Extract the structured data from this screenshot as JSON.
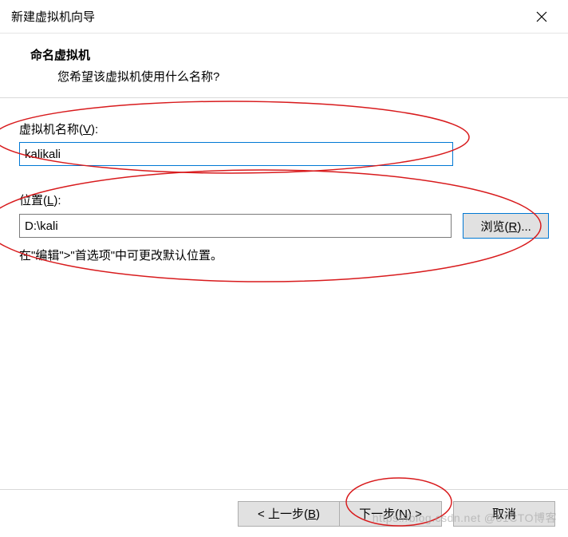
{
  "titlebar": {
    "title": "新建虚拟机向导"
  },
  "header": {
    "title": "命名虚拟机",
    "subtitle": "您希望该虚拟机使用什么名称?"
  },
  "fields": {
    "name": {
      "label_pre": "虚拟机名称(",
      "hotkey": "V",
      "label_post": "):",
      "value": "kalikali"
    },
    "location": {
      "label_pre": "位置(",
      "hotkey": "L",
      "label_post": "):",
      "value": "D:\\kali"
    },
    "browse": {
      "label_pre": "浏览(",
      "hotkey": "R",
      "label_post": ")..."
    },
    "hint": "在\"编辑\">\"首选项\"中可更改默认位置。"
  },
  "footer": {
    "back": {
      "pre": "< 上一步(",
      "hotkey": "B",
      "post": ")"
    },
    "next": {
      "pre": "下一步(",
      "hotkey": "N",
      "post": ") >"
    },
    "cancel": "取消"
  },
  "watermark": "https://blog.csdn.net @51CTO博客"
}
